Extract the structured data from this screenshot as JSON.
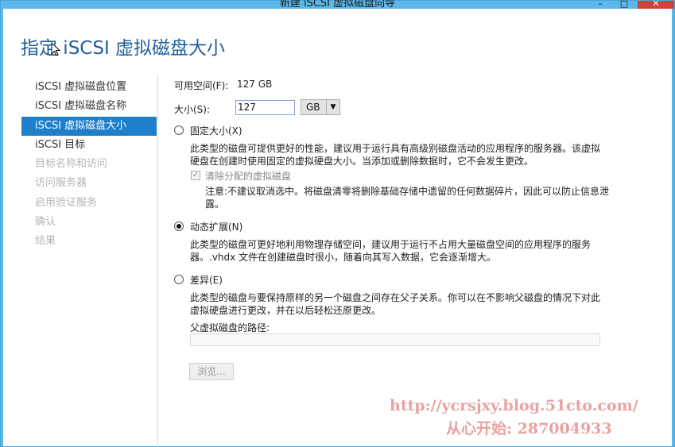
{
  "window": {
    "title": "新建 iSCSI 虚拟磁盘向导",
    "controls": {
      "minimize": "–",
      "maximize": "□",
      "close": "✕"
    }
  },
  "page_title": "指定 iSCSI 虚拟磁盘大小",
  "nav": {
    "items": [
      {
        "label": "iSCSI 虚拟磁盘位置",
        "state": "normal"
      },
      {
        "label": "iSCSI 虚拟磁盘名称",
        "state": "normal"
      },
      {
        "label": "iSCSI 虚拟磁盘大小",
        "state": "selected"
      },
      {
        "label": "iSCSI 目标",
        "state": "normal"
      },
      {
        "label": "目标名称和访问",
        "state": "disabled"
      },
      {
        "label": "访问服务器",
        "state": "disabled"
      },
      {
        "label": "启用验证服务",
        "state": "disabled"
      },
      {
        "label": "确认",
        "state": "disabled"
      },
      {
        "label": "结果",
        "state": "disabled"
      }
    ]
  },
  "free_space": {
    "label": "可用空间(F):",
    "value": "127 GB"
  },
  "size": {
    "label": "大小(S):",
    "value": "127",
    "unit": "GB"
  },
  "options": {
    "fixed": {
      "label": "固定大小(X)",
      "checked": false,
      "desc": "此类型的磁盘可提供更好的性能，建议用于运行具有高级别磁盘活动的应用程序的服务器。该虚拟硬盘在创建时使用固定的虚拟硬盘大小。当添加或删除数据时，它不会发生更改。",
      "clear_checkbox": {
        "label": "清除分配的虚拟磁盘",
        "checked": true,
        "mark": "✓"
      },
      "clear_note": "注意:不建议取消选中。将磁盘清零将删除基础存储中遗留的任何数据碎片，因此可以防止信息泄露。"
    },
    "dynamic": {
      "label": "动态扩展(N)",
      "checked": true,
      "desc": "此类型的磁盘可更好地利用物理存储空间，建议用于运行不占用大量磁盘空间的应用程序的服务器。.vhdx 文件在创建磁盘时很小，随着向其写入数据，它会逐渐增大。"
    },
    "differencing": {
      "label": "差异(E)",
      "checked": false,
      "desc": "此类型的磁盘与要保持原样的另一个磁盘之间存在父子关系。你可以在不影响父磁盘的情况下对此虚拟硬盘进行更改，并在以后轻松还原更改。",
      "parent_path_label": "父虚拟磁盘的路径:",
      "parent_path_value": "",
      "browse_label": "浏览..."
    }
  },
  "watermark": {
    "line1": "http://ycrsjxy.blog.51cto.com/",
    "line2": "从心开始: 287004933"
  },
  "colors": {
    "accent": "#1e7fcb",
    "title_blue": "#1f5f99",
    "titlebar": "#5bb8e8",
    "close": "#c9463d"
  }
}
